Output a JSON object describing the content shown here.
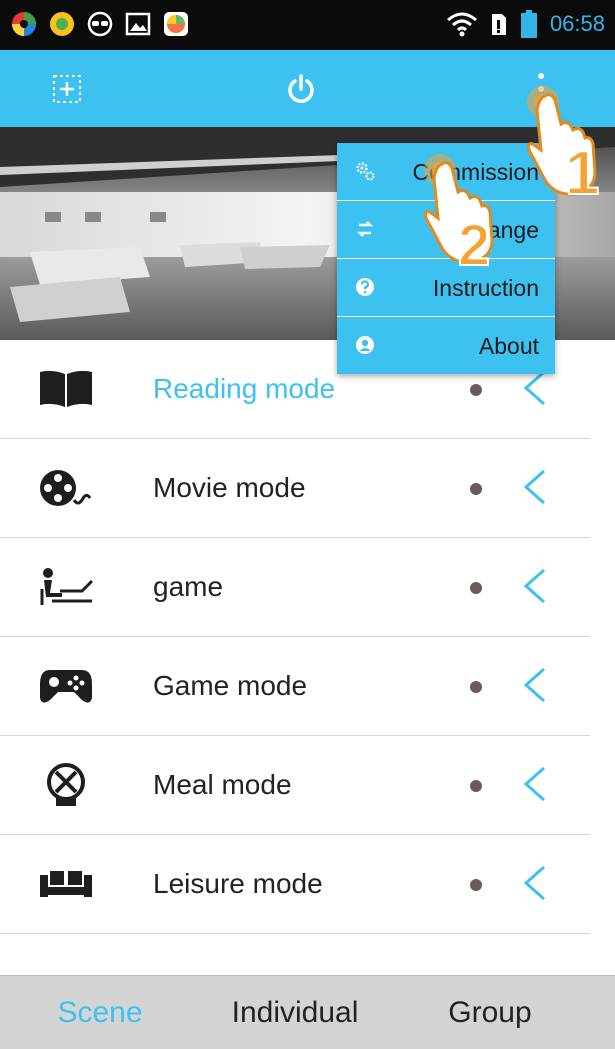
{
  "status_bar": {
    "time": "06:58",
    "icons": [
      "color-app-icon",
      "green-app-icon",
      "goggles-icon",
      "image-icon",
      "photos-icon",
      "wifi-icon",
      "sim-icon",
      "battery-icon"
    ]
  },
  "app_bar": {
    "left_icon": "add-box-icon",
    "center_icon": "power-icon",
    "right_icon": "overflow-menu-icon"
  },
  "scenes": [
    {
      "label": "Reading mode",
      "icon": "book-icon",
      "active": true
    },
    {
      "label": "Movie mode",
      "icon": "film-reel-icon",
      "active": false
    },
    {
      "label": "game",
      "icon": "lounger-icon",
      "active": false
    },
    {
      "label": "Game mode",
      "icon": "gamepad-icon",
      "active": false
    },
    {
      "label": "Meal mode",
      "icon": "meal-icon",
      "active": false
    },
    {
      "label": "Leisure mode",
      "icon": "sofa-icon",
      "active": false
    }
  ],
  "overflow_menu": {
    "items": [
      {
        "label": "Commission",
        "icon": "settings-gears-icon"
      },
      {
        "label": "Exchange",
        "icon": "swap-arrows-icon"
      },
      {
        "label": "Instruction",
        "icon": "help-icon"
      },
      {
        "label": "About",
        "icon": "about-icon"
      }
    ]
  },
  "annotations": [
    "1",
    "2"
  ],
  "bottom_tabs": [
    {
      "label": "Scene",
      "active": true
    },
    {
      "label": "Individual",
      "active": false
    },
    {
      "label": "Group",
      "active": false
    }
  ],
  "colors": {
    "accent": "#3cc1f0",
    "status_time": "#33b5e5",
    "annotation": "#f5a233"
  }
}
